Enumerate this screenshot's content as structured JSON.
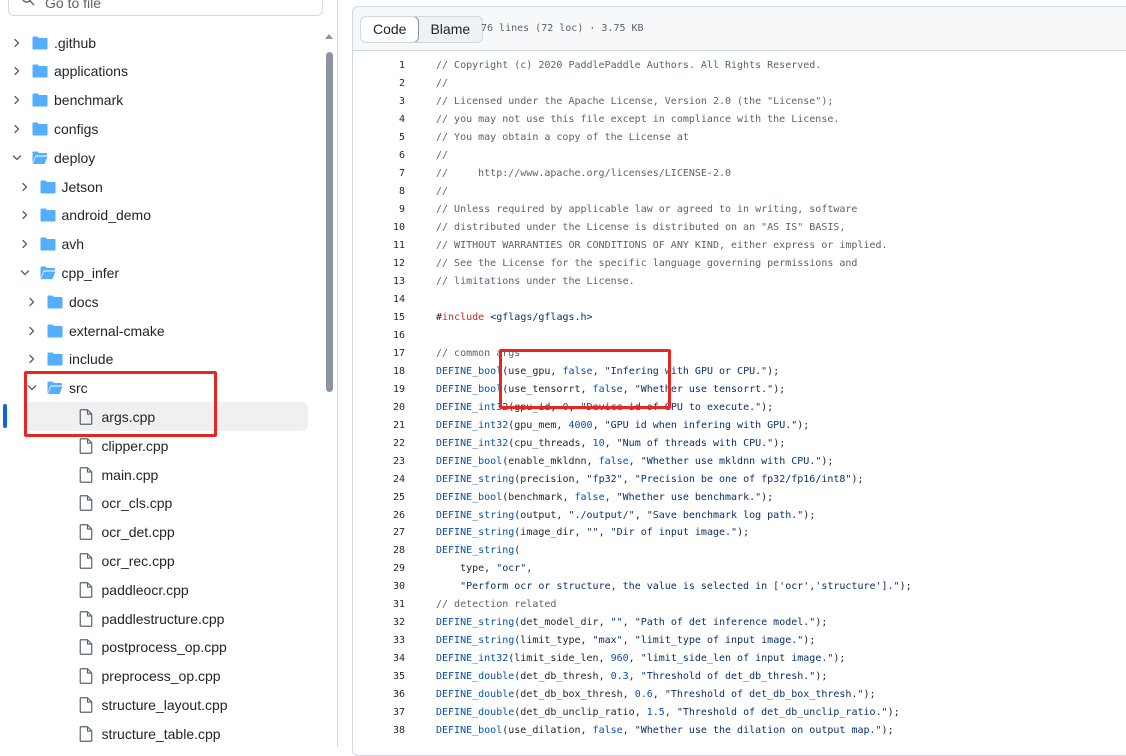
{
  "search": {
    "placeholder": "Go to file"
  },
  "tree": [
    {
      "label": ".github",
      "kind": "folder",
      "depth": 0,
      "expanded": false
    },
    {
      "label": "applications",
      "kind": "folder",
      "depth": 0,
      "expanded": false
    },
    {
      "label": "benchmark",
      "kind": "folder",
      "depth": 0,
      "expanded": false
    },
    {
      "label": "configs",
      "kind": "folder",
      "depth": 0,
      "expanded": false
    },
    {
      "label": "deploy",
      "kind": "folder",
      "depth": 0,
      "expanded": true
    },
    {
      "label": "Jetson",
      "kind": "folder",
      "depth": 1,
      "expanded": false
    },
    {
      "label": "android_demo",
      "kind": "folder",
      "depth": 1,
      "expanded": false
    },
    {
      "label": "avh",
      "kind": "folder",
      "depth": 1,
      "expanded": false
    },
    {
      "label": "cpp_infer",
      "kind": "folder",
      "depth": 1,
      "expanded": true
    },
    {
      "label": "docs",
      "kind": "folder",
      "depth": 2,
      "expanded": false
    },
    {
      "label": "external-cmake",
      "kind": "folder",
      "depth": 2,
      "expanded": false
    },
    {
      "label": "include",
      "kind": "folder",
      "depth": 2,
      "expanded": false
    },
    {
      "label": "src",
      "kind": "folder",
      "depth": 2,
      "expanded": true
    },
    {
      "label": "args.cpp",
      "kind": "file",
      "depth": 3,
      "selected": true
    },
    {
      "label": "clipper.cpp",
      "kind": "file",
      "depth": 3
    },
    {
      "label": "main.cpp",
      "kind": "file",
      "depth": 3
    },
    {
      "label": "ocr_cls.cpp",
      "kind": "file",
      "depth": 3
    },
    {
      "label": "ocr_det.cpp",
      "kind": "file",
      "depth": 3
    },
    {
      "label": "ocr_rec.cpp",
      "kind": "file",
      "depth": 3
    },
    {
      "label": "paddleocr.cpp",
      "kind": "file",
      "depth": 3
    },
    {
      "label": "paddlestructure.cpp",
      "kind": "file",
      "depth": 3
    },
    {
      "label": "postprocess_op.cpp",
      "kind": "file",
      "depth": 3
    },
    {
      "label": "preprocess_op.cpp",
      "kind": "file",
      "depth": 3
    },
    {
      "label": "structure_layout.cpp",
      "kind": "file",
      "depth": 3
    },
    {
      "label": "structure_table.cpp",
      "kind": "file",
      "depth": 3
    }
  ],
  "code_view": {
    "tabs": {
      "code": "Code",
      "blame": "Blame",
      "active": "Code"
    },
    "meta": "76 lines (72 loc) · 3.75 KB",
    "lines": [
      {
        "n": "1",
        "parts": [
          [
            "c",
            "// Copyright (c) 2020 PaddlePaddle Authors. All Rights Reserved."
          ]
        ]
      },
      {
        "n": "2",
        "parts": [
          [
            "c",
            "//"
          ]
        ]
      },
      {
        "n": "3",
        "parts": [
          [
            "c",
            "// Licensed under the Apache License, Version 2.0 (the \"License\");"
          ]
        ]
      },
      {
        "n": "4",
        "parts": [
          [
            "c",
            "// you may not use this file except in compliance with the License."
          ]
        ]
      },
      {
        "n": "5",
        "parts": [
          [
            "c",
            "// You may obtain a copy of the License at"
          ]
        ]
      },
      {
        "n": "6",
        "parts": [
          [
            "c",
            "//"
          ]
        ]
      },
      {
        "n": "7",
        "parts": [
          [
            "c",
            "//     http://www.apache.org/licenses/LICENSE-2.0"
          ]
        ]
      },
      {
        "n": "8",
        "parts": [
          [
            "c",
            "//"
          ]
        ]
      },
      {
        "n": "9",
        "parts": [
          [
            "c",
            "// Unless required by applicable law or agreed to in writing, software"
          ]
        ]
      },
      {
        "n": "10",
        "parts": [
          [
            "c",
            "// distributed under the License is distributed on an \"AS IS\" BASIS,"
          ]
        ]
      },
      {
        "n": "11",
        "parts": [
          [
            "c",
            "// WITHOUT WARRANTIES OR CONDITIONS OF ANY KIND, either express or implied."
          ]
        ]
      },
      {
        "n": "12",
        "parts": [
          [
            "c",
            "// See the License for the specific language governing permissions and"
          ]
        ]
      },
      {
        "n": "13",
        "parts": [
          [
            "c",
            "// limitations under the License."
          ]
        ]
      },
      {
        "n": "14",
        "parts": []
      },
      {
        "n": "15",
        "parts": [
          [
            "p",
            "#"
          ],
          [
            "k",
            "include"
          ],
          [
            "p",
            " "
          ],
          [
            "s",
            "<gflags/gflags.h>"
          ]
        ]
      },
      {
        "n": "16",
        "parts": []
      },
      {
        "n": "17",
        "parts": [
          [
            "c",
            "// common args"
          ]
        ]
      },
      {
        "n": "18",
        "parts": [
          [
            "m",
            "DEFINE_bool"
          ],
          [
            "p",
            "(use_gpu, "
          ],
          [
            "m",
            "false"
          ],
          [
            "p",
            ", "
          ],
          [
            "s",
            "\"Infering with GPU or CPU.\""
          ],
          [
            "p",
            ");"
          ]
        ]
      },
      {
        "n": "19",
        "parts": [
          [
            "m",
            "DEFINE_bool"
          ],
          [
            "p",
            "(use_tensorrt, "
          ],
          [
            "m",
            "false"
          ],
          [
            "p",
            ", "
          ],
          [
            "s",
            "\"Whether use tensorrt.\""
          ],
          [
            "p",
            ");"
          ]
        ]
      },
      {
        "n": "20",
        "parts": [
          [
            "m",
            "DEFINE_int32"
          ],
          [
            "p",
            "(gpu_id, "
          ],
          [
            "m",
            "0"
          ],
          [
            "p",
            ", "
          ],
          [
            "s",
            "\"Device id of GPU to execute.\""
          ],
          [
            "p",
            ");"
          ]
        ]
      },
      {
        "n": "21",
        "parts": [
          [
            "m",
            "DEFINE_int32"
          ],
          [
            "p",
            "(gpu_mem, "
          ],
          [
            "m",
            "4000"
          ],
          [
            "p",
            ", "
          ],
          [
            "s",
            "\"GPU id when infering with GPU.\""
          ],
          [
            "p",
            ");"
          ]
        ]
      },
      {
        "n": "22",
        "parts": [
          [
            "m",
            "DEFINE_int32"
          ],
          [
            "p",
            "(cpu_threads, "
          ],
          [
            "m",
            "10"
          ],
          [
            "p",
            ", "
          ],
          [
            "s",
            "\"Num of threads with CPU.\""
          ],
          [
            "p",
            ");"
          ]
        ]
      },
      {
        "n": "23",
        "parts": [
          [
            "m",
            "DEFINE_bool"
          ],
          [
            "p",
            "(enable_mkldnn, "
          ],
          [
            "m",
            "false"
          ],
          [
            "p",
            ", "
          ],
          [
            "s",
            "\"Whether use mkldnn with CPU.\""
          ],
          [
            "p",
            ");"
          ]
        ]
      },
      {
        "n": "24",
        "parts": [
          [
            "m",
            "DEFINE_string"
          ],
          [
            "p",
            "(precision, "
          ],
          [
            "s",
            "\"fp32\""
          ],
          [
            "p",
            ", "
          ],
          [
            "s",
            "\"Precision be one of fp32/fp16/int8\""
          ],
          [
            "p",
            ");"
          ]
        ]
      },
      {
        "n": "25",
        "parts": [
          [
            "m",
            "DEFINE_bool"
          ],
          [
            "p",
            "(benchmark, "
          ],
          [
            "m",
            "false"
          ],
          [
            "p",
            ", "
          ],
          [
            "s",
            "\"Whether use benchmark.\""
          ],
          [
            "p",
            ");"
          ]
        ]
      },
      {
        "n": "26",
        "parts": [
          [
            "m",
            "DEFINE_string"
          ],
          [
            "p",
            "(output, "
          ],
          [
            "s",
            "\"./output/\""
          ],
          [
            "p",
            ", "
          ],
          [
            "s",
            "\"Save benchmark log path.\""
          ],
          [
            "p",
            ");"
          ]
        ]
      },
      {
        "n": "27",
        "parts": [
          [
            "m",
            "DEFINE_string"
          ],
          [
            "p",
            "(image_dir, "
          ],
          [
            "s",
            "\"\""
          ],
          [
            "p",
            ", "
          ],
          [
            "s",
            "\"Dir of input image.\""
          ],
          [
            "p",
            ");"
          ]
        ]
      },
      {
        "n": "28",
        "parts": [
          [
            "m",
            "DEFINE_string"
          ],
          [
            "p",
            "("
          ]
        ]
      },
      {
        "n": "29",
        "parts": [
          [
            "p",
            "    type, "
          ],
          [
            "s",
            "\"ocr\""
          ],
          [
            "p",
            ","
          ]
        ]
      },
      {
        "n": "30",
        "parts": [
          [
            "p",
            "    "
          ],
          [
            "s",
            "\"Perform ocr or structure, the value is selected in ['ocr','structure'].\""
          ],
          [
            "p",
            ");"
          ]
        ]
      },
      {
        "n": "31",
        "parts": [
          [
            "c",
            "// detection related"
          ]
        ]
      },
      {
        "n": "32",
        "parts": [
          [
            "m",
            "DEFINE_string"
          ],
          [
            "p",
            "(det_model_dir, "
          ],
          [
            "s",
            "\"\""
          ],
          [
            "p",
            ", "
          ],
          [
            "s",
            "\"Path of det inference model.\""
          ],
          [
            "p",
            ");"
          ]
        ]
      },
      {
        "n": "33",
        "parts": [
          [
            "m",
            "DEFINE_string"
          ],
          [
            "p",
            "(limit_type, "
          ],
          [
            "s",
            "\"max\""
          ],
          [
            "p",
            ", "
          ],
          [
            "s",
            "\"limit_type of input image.\""
          ],
          [
            "p",
            ");"
          ]
        ]
      },
      {
        "n": "34",
        "parts": [
          [
            "m",
            "DEFINE_int32"
          ],
          [
            "p",
            "(limit_side_len, "
          ],
          [
            "m",
            "960"
          ],
          [
            "p",
            ", "
          ],
          [
            "s",
            "\"limit_side_len of input image.\""
          ],
          [
            "p",
            ");"
          ]
        ]
      },
      {
        "n": "35",
        "parts": [
          [
            "m",
            "DEFINE_double"
          ],
          [
            "p",
            "(det_db_thresh, "
          ],
          [
            "m",
            "0.3"
          ],
          [
            "p",
            ", "
          ],
          [
            "s",
            "\"Threshold of det_db_thresh.\""
          ],
          [
            "p",
            ");"
          ]
        ]
      },
      {
        "n": "36",
        "parts": [
          [
            "m",
            "DEFINE_double"
          ],
          [
            "p",
            "(det_db_box_thresh, "
          ],
          [
            "m",
            "0.6"
          ],
          [
            "p",
            ", "
          ],
          [
            "s",
            "\"Threshold of det_db_box_thresh.\""
          ],
          [
            "p",
            ");"
          ]
        ]
      },
      {
        "n": "37",
        "parts": [
          [
            "m",
            "DEFINE_double"
          ],
          [
            "p",
            "(det_db_unclip_ratio, "
          ],
          [
            "m",
            "1.5"
          ],
          [
            "p",
            ", "
          ],
          [
            "s",
            "\"Threshold of det_db_unclip_ratio.\""
          ],
          [
            "p",
            ");"
          ]
        ]
      },
      {
        "n": "38",
        "parts": [
          [
            "m",
            "DEFINE_bool"
          ],
          [
            "p",
            "(use_dilation, "
          ],
          [
            "m",
            "false"
          ],
          [
            "p",
            ", "
          ],
          [
            "s",
            "\"Whether use the dilation on output map.\""
          ],
          [
            "p",
            ");"
          ]
        ]
      }
    ]
  },
  "colors": {
    "accent": "#0969da",
    "folder": "#54aeff",
    "annotation": "#e8251f",
    "comment": "#59636e",
    "macro": "#0550ae",
    "keyword": "#cf222e",
    "string": "#0a3069"
  },
  "icons": {
    "search": "search-icon",
    "folder": "folder-icon",
    "file": "file-icon",
    "chevron_right": "chevron-right-icon",
    "chevron_down": "chevron-down-icon"
  }
}
